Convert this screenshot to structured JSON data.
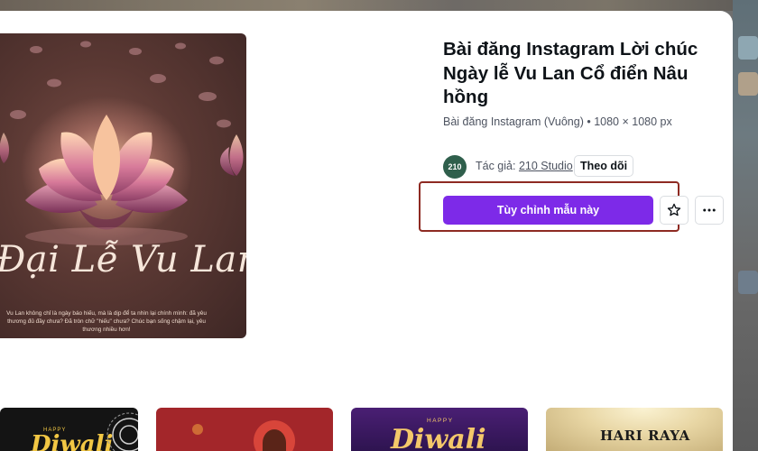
{
  "template": {
    "title": "Bài đăng Instagram Lời chúc Ngày lễ Vu Lan Cổ điển Nâu hồng",
    "subtitle": "Bài đăng Instagram (Vuông) • 1080 × 1080 px"
  },
  "author": {
    "avatar_text": "210",
    "label": "Tác giả:",
    "name": "210 Studio",
    "follow_label": "Theo dõi"
  },
  "actions": {
    "customize_label": "Tùy chỉnh mẫu này",
    "favorite_icon": "star-outline-icon",
    "more_icon": "more-dots-icon"
  },
  "preview": {
    "heading": "Đại Lễ Vu Lan",
    "caption": "Vu Lan không chỉ là ngày báo hiếu, mà là dịp để ta nhìn lại chính mình: đã yêu thương đủ đầy chưa? Đã tròn chữ \"hiếu\" chưa? Chúc bạn sống chậm lại, yêu thương nhiều hơn!"
  },
  "related": [
    {
      "top_text": "HAPPY",
      "main_text": "Diwali"
    },
    {
      "top_text": "",
      "main_text": ""
    },
    {
      "top_text": "HAPPY",
      "main_text": "Diwali"
    },
    {
      "top_text": "",
      "main_text": "HARI RAYA"
    }
  ],
  "colors": {
    "accent": "#7d2ae8",
    "highlight_frame": "#8e2a22",
    "avatar_bg": "#2f5f4c"
  }
}
